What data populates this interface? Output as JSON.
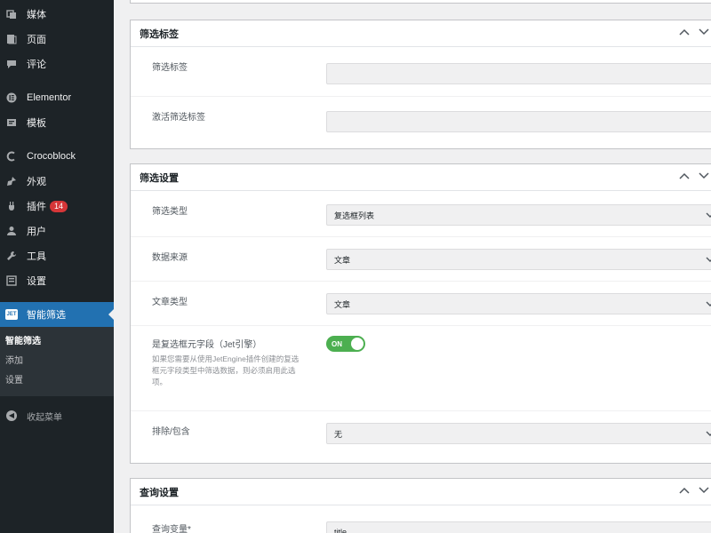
{
  "sidebar": {
    "items": [
      {
        "label": "媒体",
        "icon": "media-icon"
      },
      {
        "label": "页面",
        "icon": "pages-icon"
      },
      {
        "label": "评论",
        "icon": "comments-icon"
      },
      {
        "label": "Elementor",
        "icon": "elementor-icon"
      },
      {
        "label": "模板",
        "icon": "templates-icon"
      },
      {
        "label": "Crocoblock",
        "icon": "crocoblock-icon"
      },
      {
        "label": "外观",
        "icon": "appearance-icon"
      },
      {
        "label": "插件",
        "icon": "plugins-icon",
        "badge": "14"
      },
      {
        "label": "用户",
        "icon": "users-icon"
      },
      {
        "label": "工具",
        "icon": "tools-icon"
      },
      {
        "label": "设置",
        "icon": "settings-icon"
      }
    ],
    "active": {
      "label": "智能筛选",
      "logo": "JET"
    },
    "submenu": [
      {
        "label": "智能筛选"
      },
      {
        "label": "添加"
      },
      {
        "label": "设置"
      }
    ],
    "collapse_label": "收起菜单"
  },
  "panels": {
    "labels": {
      "title": "筛选标签",
      "rows": [
        {
          "label": "筛选标签"
        },
        {
          "label": "激活筛选标签"
        }
      ]
    },
    "settings": {
      "title": "筛选设置",
      "filter_type_label": "筛选类型",
      "filter_type_value": "复选框列表",
      "source_label": "数据来源",
      "source_value": "文章",
      "post_type_label": "文章类型",
      "post_type_value": "文章",
      "glossary_label": "是复选框元字段（Jet引擎）",
      "glossary_toggle": "ON",
      "glossary_help": "如果您需要从使用JetEngine插件创建的复选框元字段类型中筛选数据，则必须启用此选项。",
      "exclude_label": "排除/包含",
      "exclude_value": "无"
    },
    "query": {
      "title": "查询设置",
      "var_label": "查询变量*",
      "var_value": "title"
    }
  },
  "colors": {
    "sidebar_bg": "#1d2327",
    "active_bg": "#2271b1",
    "badge": "#d63638",
    "toggle_on": "#4caf50"
  }
}
